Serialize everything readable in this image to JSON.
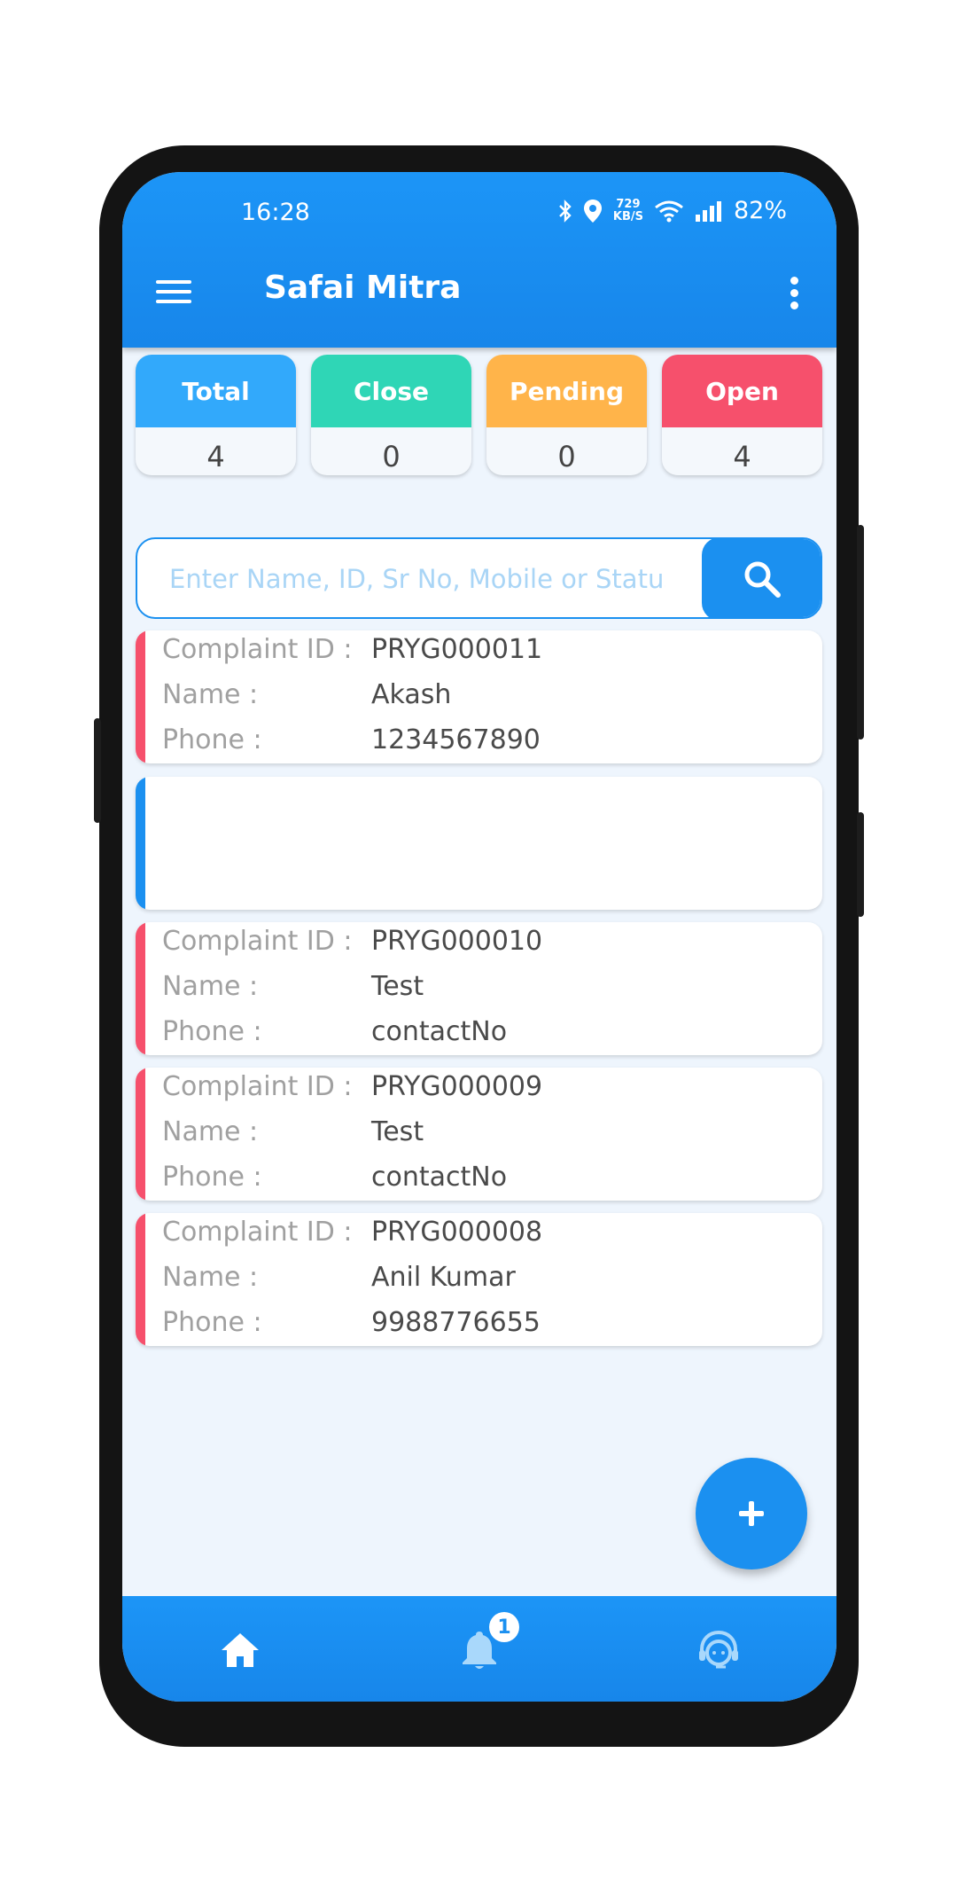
{
  "status_bar": {
    "time": "16:28",
    "speed_value": "729",
    "speed_unit": "KB/S",
    "battery": "82%"
  },
  "app_bar": {
    "title": "Safai Mitra"
  },
  "stats": [
    {
      "label": "Total",
      "value": "4",
      "color": "#32a9fb"
    },
    {
      "label": "Close",
      "value": "0",
      "color": "#2fd6b6"
    },
    {
      "label": "Pending",
      "value": "0",
      "color": "#ffb44a"
    },
    {
      "label": "Open",
      "value": "4",
      "color": "#f6506c"
    }
  ],
  "search": {
    "placeholder": "Enter Name, ID, Sr No, Mobile or Status"
  },
  "labels": {
    "complaint_id": "Complaint ID :",
    "name": "Name :",
    "phone": "Phone :"
  },
  "complaints": [
    {
      "id": "PRYG000011",
      "name": "Akash",
      "phone": "1234567890",
      "status_color": "#f6506c"
    },
    {
      "id": "",
      "name": "",
      "phone": "",
      "status_color": "#1b90f0"
    },
    {
      "id": "PRYG000010",
      "name": "Test",
      "phone": "contactNo",
      "status_color": "#f6506c"
    },
    {
      "id": "PRYG000009",
      "name": "Test",
      "phone": "contactNo",
      "status_color": "#f6506c"
    },
    {
      "id": "PRYG000008",
      "name": "Anil Kumar",
      "phone": "9988776655",
      "status_color": "#f6506c"
    }
  ],
  "bottom_nav": {
    "notification_count": "1"
  }
}
